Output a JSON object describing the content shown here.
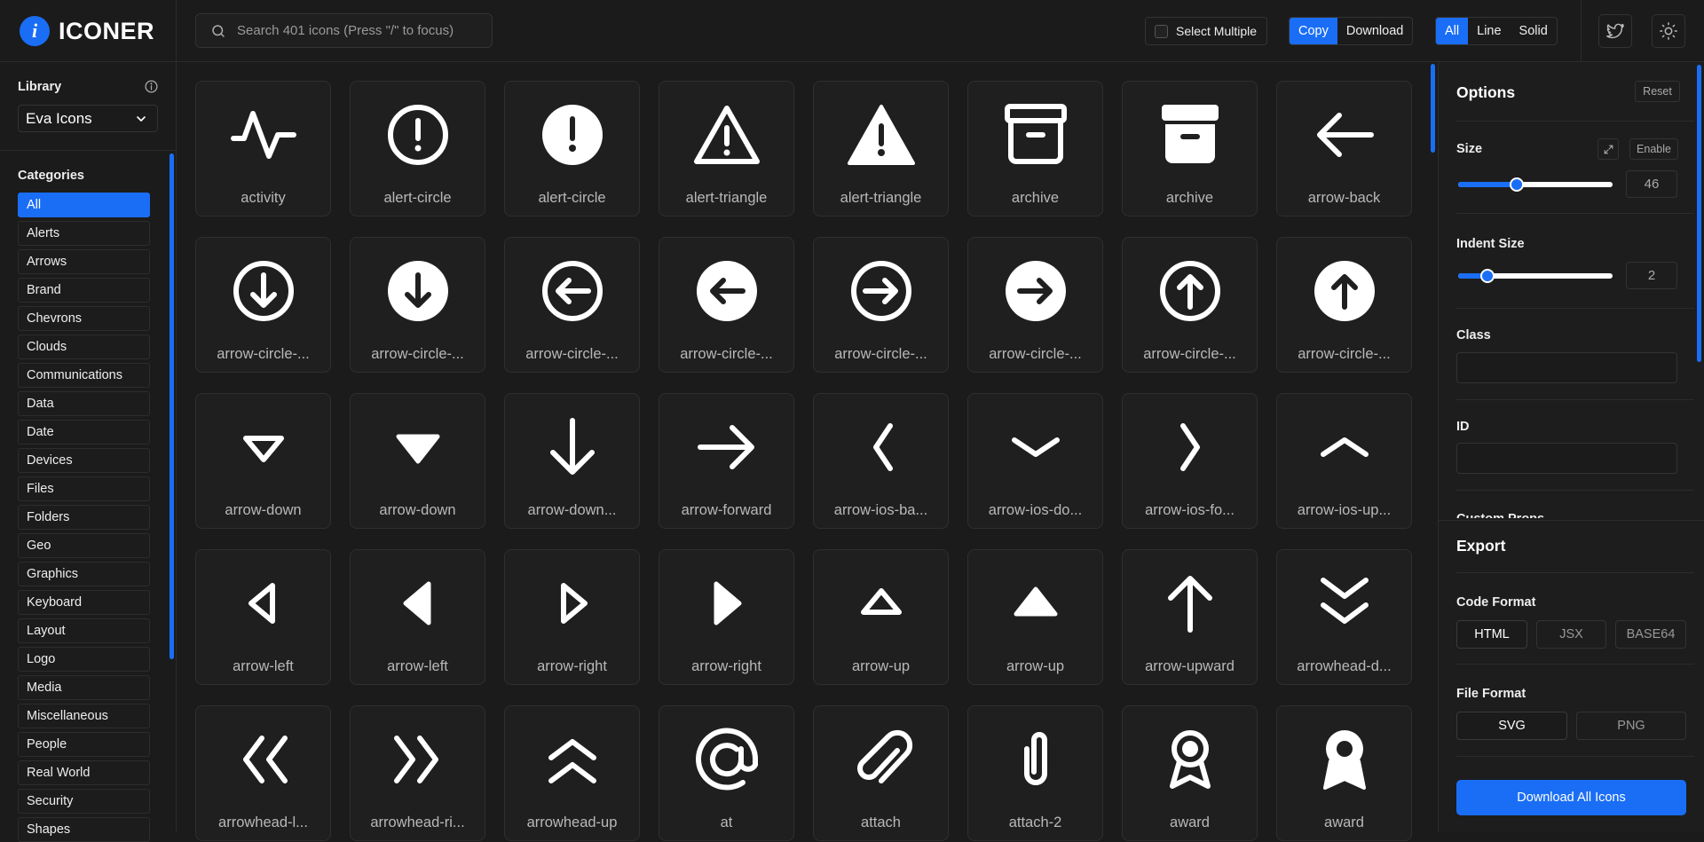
{
  "app": {
    "name": "ICONER",
    "logo_glyph": "i"
  },
  "search": {
    "placeholder": "Search 401 icons (Press \"/\" to focus)",
    "value": ""
  },
  "toolbar": {
    "select_multiple_label": "Select Multiple",
    "action_modes": [
      {
        "label": "Copy",
        "active": true
      },
      {
        "label": "Download",
        "active": false
      }
    ],
    "style_filters": [
      {
        "label": "All",
        "active": true
      },
      {
        "label": "Line",
        "active": false
      },
      {
        "label": "Solid",
        "active": false
      }
    ]
  },
  "sidebar": {
    "library_label": "Library",
    "library_value": "Eva Icons",
    "categories_label": "Categories",
    "categories": [
      "All",
      "Alerts",
      "Arrows",
      "Brand",
      "Chevrons",
      "Clouds",
      "Communications",
      "Data",
      "Date",
      "Devices",
      "Files",
      "Folders",
      "Geo",
      "Graphics",
      "Keyboard",
      "Layout",
      "Logo",
      "Media",
      "Miscellaneous",
      "People",
      "Real World",
      "Security",
      "Shapes"
    ],
    "active_category": "All"
  },
  "icons": [
    {
      "label": "activity",
      "icon": "activity"
    },
    {
      "label": "alert-circle",
      "icon": "alert-circle-outline"
    },
    {
      "label": "alert-circle",
      "icon": "alert-circle-fill"
    },
    {
      "label": "alert-triangle",
      "icon": "alert-triangle-outline"
    },
    {
      "label": "alert-triangle",
      "icon": "alert-triangle-fill"
    },
    {
      "label": "archive",
      "icon": "archive-outline"
    },
    {
      "label": "archive",
      "icon": "archive-fill"
    },
    {
      "label": "arrow-back",
      "icon": "arrow-back"
    },
    {
      "label": "arrow-circle-...",
      "icon": "arrow-circle-down-outline"
    },
    {
      "label": "arrow-circle-...",
      "icon": "arrow-circle-down-fill"
    },
    {
      "label": "arrow-circle-...",
      "icon": "arrow-circle-left-outline"
    },
    {
      "label": "arrow-circle-...",
      "icon": "arrow-circle-left-fill"
    },
    {
      "label": "arrow-circle-...",
      "icon": "arrow-circle-right-outline"
    },
    {
      "label": "arrow-circle-...",
      "icon": "arrow-circle-right-fill"
    },
    {
      "label": "arrow-circle-...",
      "icon": "arrow-circle-up-outline"
    },
    {
      "label": "arrow-circle-...",
      "icon": "arrow-circle-up-fill"
    },
    {
      "label": "arrow-down",
      "icon": "triangle-down-outline"
    },
    {
      "label": "arrow-down",
      "icon": "triangle-down-fill"
    },
    {
      "label": "arrow-down...",
      "icon": "arrow-downward"
    },
    {
      "label": "arrow-forward",
      "icon": "arrow-forward"
    },
    {
      "label": "arrow-ios-ba...",
      "icon": "chevron-left"
    },
    {
      "label": "arrow-ios-do...",
      "icon": "chevron-down"
    },
    {
      "label": "arrow-ios-fo...",
      "icon": "chevron-right"
    },
    {
      "label": "arrow-ios-up...",
      "icon": "chevron-up"
    },
    {
      "label": "arrow-left",
      "icon": "triangle-left-outline"
    },
    {
      "label": "arrow-left",
      "icon": "triangle-left-fill"
    },
    {
      "label": "arrow-right",
      "icon": "triangle-right-outline"
    },
    {
      "label": "arrow-right",
      "icon": "triangle-right-fill"
    },
    {
      "label": "arrow-up",
      "icon": "triangle-up-outline"
    },
    {
      "label": "arrow-up",
      "icon": "triangle-up-fill"
    },
    {
      "label": "arrow-upward",
      "icon": "arrow-upward"
    },
    {
      "label": "arrowhead-d...",
      "icon": "arrowhead-down"
    },
    {
      "label": "arrowhead-l...",
      "icon": "arrowhead-left"
    },
    {
      "label": "arrowhead-ri...",
      "icon": "arrowhead-right"
    },
    {
      "label": "arrowhead-up",
      "icon": "arrowhead-up"
    },
    {
      "label": "at",
      "icon": "at"
    },
    {
      "label": "attach",
      "icon": "attach"
    },
    {
      "label": "attach-2",
      "icon": "attach-2"
    },
    {
      "label": "award",
      "icon": "award-outline"
    },
    {
      "label": "award",
      "icon": "award-fill"
    }
  ],
  "options": {
    "title": "Options",
    "reset_label": "Reset",
    "size_label": "Size",
    "size_enable_label": "Enable",
    "size_value": "46",
    "size_fraction": 0.38,
    "indent_label": "Indent Size",
    "indent_value": "2",
    "indent_fraction": 0.19,
    "class_label": "Class",
    "id_label": "ID",
    "custom_props_label": "Custom Props"
  },
  "export": {
    "title": "Export",
    "code_format_label": "Code Format",
    "code_formats": [
      {
        "label": "HTML",
        "active": true
      },
      {
        "label": "JSX",
        "active": false
      },
      {
        "label": "BASE64",
        "active": false
      }
    ],
    "file_format_label": "File Format",
    "file_formats": [
      {
        "label": "SVG",
        "active": true
      },
      {
        "label": "PNG",
        "active": false
      }
    ],
    "download_all_label": "Download All Icons"
  },
  "colors": {
    "accent": "#1a6ef5",
    "background": "#1b1b1b",
    "card": "#1f1f1f"
  }
}
